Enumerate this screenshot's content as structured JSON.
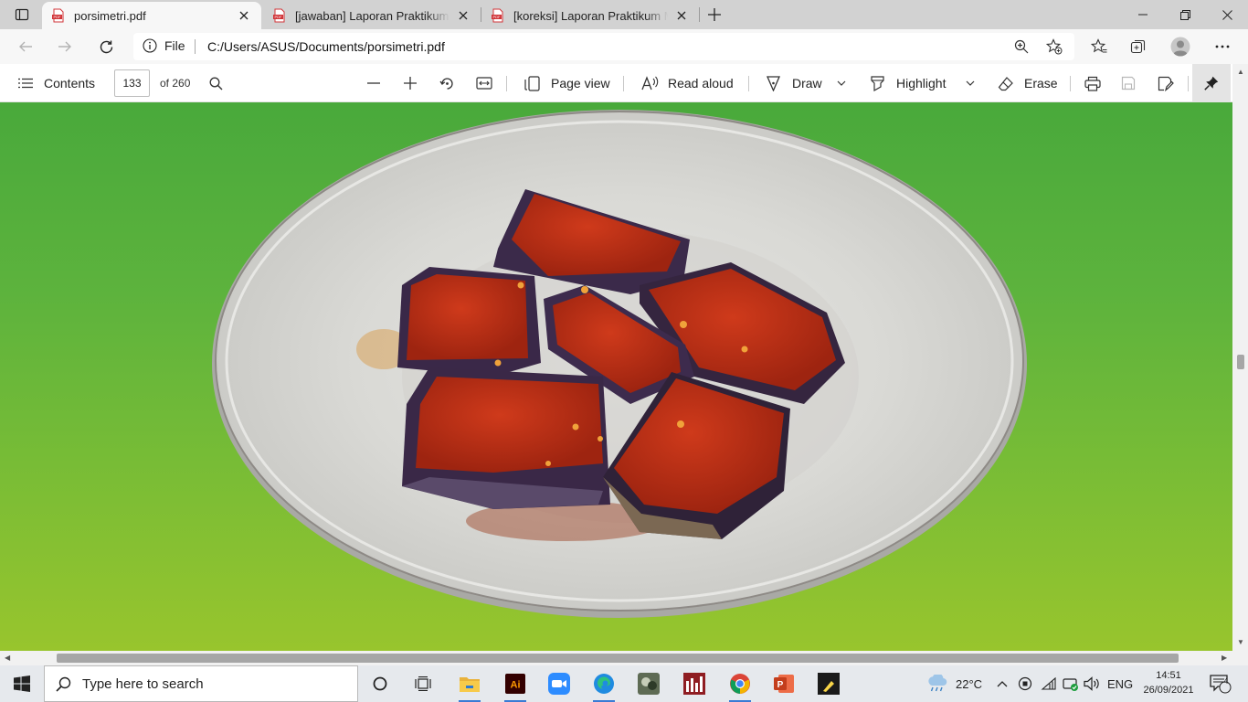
{
  "tabs": [
    {
      "title": "porsimetri.pdf",
      "active": true
    },
    {
      "title": "[jawaban] Laporan Praktikum Ma",
      "active": false
    },
    {
      "title": "[koreksi] Laporan Praktikum Mat",
      "active": false
    }
  ],
  "address": {
    "scheme_label": "File",
    "url": "C:/Users/ASUS/Documents/porsimetri.pdf"
  },
  "pdf_toolbar": {
    "contents_label": "Contents",
    "current_page": "133",
    "page_count_label": "of 260",
    "page_view_label": "Page view",
    "read_aloud_label": "Read aloud",
    "draw_label": "Draw",
    "highlight_label": "Highlight",
    "erase_label": "Erase"
  },
  "document": {
    "image_subject": "eggplant-with-chili-sauce-on-plate",
    "background_colors": [
      "#49a93b",
      "#98c52d"
    ]
  },
  "taskbar": {
    "search_placeholder": "Type here to search",
    "pinned": [
      "task-view-icon",
      "file-explorer-icon",
      "illustrator-icon",
      "zoom-icon",
      "edge-icon",
      "game-app-icon",
      "spss-icon",
      "chrome-icon",
      "powerpoint-icon",
      "sticky-notes-icon"
    ],
    "weather": "22°C",
    "language": "ENG",
    "time": "14:51",
    "date": "26/09/2021",
    "notification_count": "4"
  },
  "colors": {
    "tab_strip": "#d2d2d2",
    "toolbar": "#f7f7f7",
    "taskbar": "#e6e9ed",
    "pdf_red": "#d13438"
  }
}
